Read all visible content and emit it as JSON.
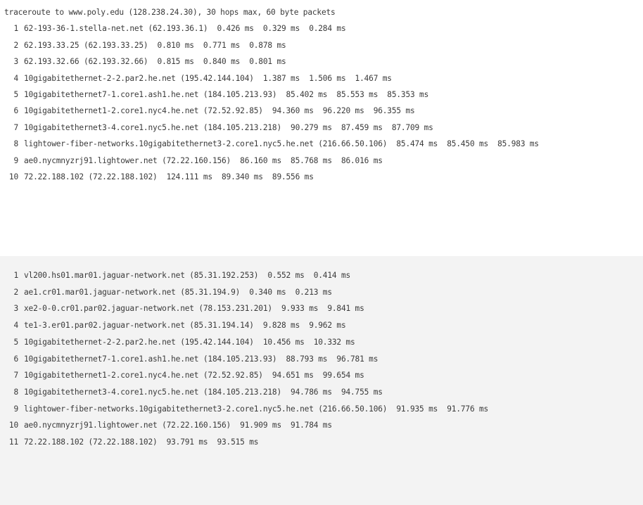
{
  "trace1": {
    "header": "traceroute to www.poly.edu (128.238.24.30), 30 hops max, 60 byte packets",
    "hops": [
      {
        "n": "1",
        "text": "62-193-36-1.stella-net.net (62.193.36.1)  0.426 ms  0.329 ms  0.284 ms"
      },
      {
        "n": "2",
        "text": "62.193.33.25 (62.193.33.25)  0.810 ms  0.771 ms  0.878 ms"
      },
      {
        "n": "3",
        "text": "62.193.32.66 (62.193.32.66)  0.815 ms  0.840 ms  0.801 ms"
      },
      {
        "n": "4",
        "text": "10gigabitethernet-2-2.par2.he.net (195.42.144.104)  1.387 ms  1.506 ms  1.467 ms"
      },
      {
        "n": "5",
        "text": "10gigabitethernet7-1.core1.ash1.he.net (184.105.213.93)  85.402 ms  85.553 ms  85.353 ms"
      },
      {
        "n": "6",
        "text": "10gigabitethernet1-2.core1.nyc4.he.net (72.52.92.85)  94.360 ms  96.220 ms  96.355 ms"
      },
      {
        "n": "7",
        "text": "10gigabitethernet3-4.core1.nyc5.he.net (184.105.213.218)  90.279 ms  87.459 ms  87.709 ms"
      },
      {
        "n": "8",
        "text": "lightower-fiber-networks.10gigabitethernet3-2.core1.nyc5.he.net (216.66.50.106)  85.474 ms  85.450 ms  85.983 ms"
      },
      {
        "n": "9",
        "text": "ae0.nycmnyzrj91.lightower.net (72.22.160.156)  86.160 ms  85.768 ms  86.016 ms"
      },
      {
        "n": "10",
        "text": "72.22.188.102 (72.22.188.102)  124.111 ms  89.340 ms  89.556 ms"
      }
    ]
  },
  "trace2": {
    "hops": [
      {
        "n": "1",
        "text": "vl200.hs01.mar01.jaguar-network.net (85.31.192.253)  0.552 ms  0.414 ms"
      },
      {
        "n": "2",
        "text": "ae1.cr01.mar01.jaguar-network.net (85.31.194.9)  0.340 ms  0.213 ms"
      },
      {
        "n": "3",
        "text": "xe2-0-0.cr01.par02.jaguar-network.net (78.153.231.201)  9.933 ms  9.841 ms"
      },
      {
        "n": "4",
        "text": "te1-3.er01.par02.jaguar-network.net (85.31.194.14)  9.828 ms  9.962 ms"
      },
      {
        "n": "5",
        "text": "10gigabitethernet-2-2.par2.he.net (195.42.144.104)  10.456 ms  10.332 ms"
      },
      {
        "n": "6",
        "text": "10gigabitethernet7-1.core1.ash1.he.net (184.105.213.93)  88.793 ms  96.781 ms"
      },
      {
        "n": "7",
        "text": "10gigabitethernet1-2.core1.nyc4.he.net (72.52.92.85)  94.651 ms  99.654 ms"
      },
      {
        "n": "8",
        "text": "10gigabitethernet3-4.core1.nyc5.he.net (184.105.213.218)  94.786 ms  94.755 ms"
      },
      {
        "n": "9",
        "text": "lightower-fiber-networks.10gigabitethernet3-2.core1.nyc5.he.net (216.66.50.106)  91.935 ms  91.776 ms"
      },
      {
        "n": "10",
        "text": "ae0.nycmnyzrj91.lightower.net (72.22.160.156)  91.909 ms  91.784 ms"
      },
      {
        "n": "11",
        "text": "72.22.188.102 (72.22.188.102)  93.791 ms  93.515 ms"
      }
    ]
  }
}
